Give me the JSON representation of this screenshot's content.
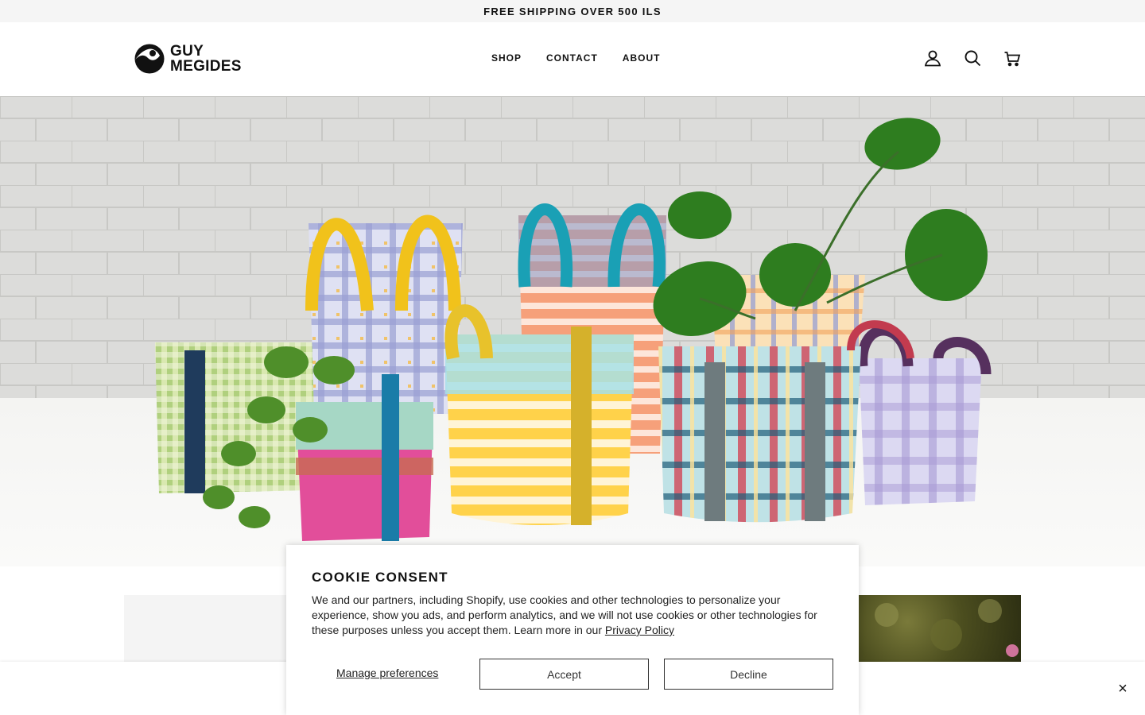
{
  "announcement": {
    "text": "FREE SHIPPING OVER 500 ILS"
  },
  "header": {
    "logo": {
      "line1": "GUY",
      "line2": "MEGIDES"
    },
    "nav": [
      {
        "label": "SHOP"
      },
      {
        "label": "CONTACT"
      },
      {
        "label": "ABOUT"
      }
    ],
    "icons": [
      "account-icon",
      "search-icon",
      "cart-icon"
    ]
  },
  "hero": {
    "image": "colorful mesh plant bags with monstera and pothos plants"
  },
  "cookie": {
    "title": "COOKIE CONSENT",
    "body": "We and our partners, including Shopify, use cookies and other technologies to personalize your experience, show you ads, and perform analytics, and we will not use cookies or other technologies for these purposes unless you accept them. Learn more in our",
    "link": "Privacy Policy",
    "manage": "Manage preferences",
    "accept": "Accept",
    "decline": "Decline"
  },
  "bottom_bar": {
    "close_icon": "close-icon",
    "close_glyph": "×"
  }
}
